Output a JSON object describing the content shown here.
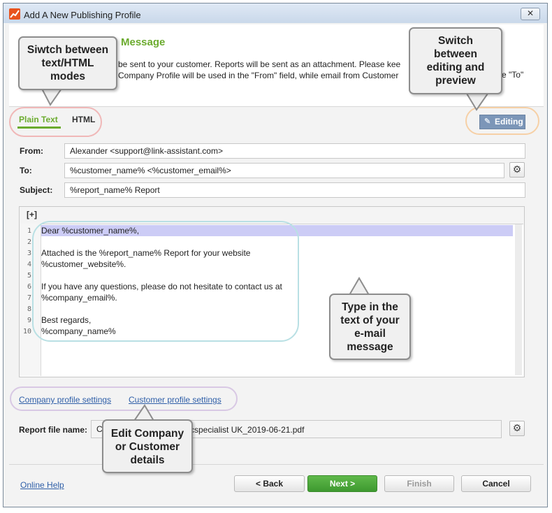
{
  "window": {
    "title": "Add A New Publishing Profile",
    "close_glyph": "✕"
  },
  "header": {
    "title": "Message",
    "description_line1": "be sent to your customer. Reports will be sent as an attachment. Please kee",
    "description_line2": "Company Profile will be used in the \"From\" field, while email from Customer",
    "description_tail": "e \"To\""
  },
  "mode_tabs": {
    "plain": "Plain Text",
    "html": "HTML"
  },
  "editing_button": {
    "label": "Editing",
    "icon": "pencil-icon"
  },
  "fields": {
    "from_label": "From:",
    "from_value": "Alexander <support@link-assistant.com>",
    "to_label": "To:",
    "to_value": "%customer_name% <%customer_email%>",
    "subject_label": "Subject:",
    "subject_value": "%report_name% Report"
  },
  "editor": {
    "toolbar": "[+]",
    "line_numbers": [
      "1",
      "2",
      "3",
      "4",
      "5",
      "6",
      "7",
      "8",
      "9",
      "10"
    ],
    "lines": [
      "Dear %customer_name%,",
      "",
      "Attached is the %report_name% Report for your website",
      "%customer_website%.",
      "",
      "If you have any questions, please do not hesitate to contact us at",
      "%company_email%.",
      "",
      "Best regards,",
      "%company_name%"
    ]
  },
  "links": {
    "company_profile": "Company profile settings",
    "customer_profile": "Customer profile settings",
    "online_help": "Online Help"
  },
  "report_file": {
    "label": "Report file name:",
    "value_start": "C",
    "value_end": "cspecialist UK_2019-06-21.pdf"
  },
  "buttons": {
    "back": "< Back",
    "next": "Next >",
    "finish": "Finish",
    "cancel": "Cancel"
  },
  "callouts": {
    "modes": [
      "Siwtch between",
      "text/HTML",
      "modes"
    ],
    "editing": [
      "Switch",
      "between",
      "editing and",
      "preview"
    ],
    "type": [
      "Type in the",
      "text of your",
      "e-mail",
      "message"
    ],
    "details": [
      "Edit Company",
      "or Customer",
      "details"
    ]
  },
  "colors": {
    "accent_green": "#6bab2e",
    "link_blue": "#2f5fa8",
    "highlight_line": "#ccccf6",
    "editing_button": "#7c96b8"
  }
}
